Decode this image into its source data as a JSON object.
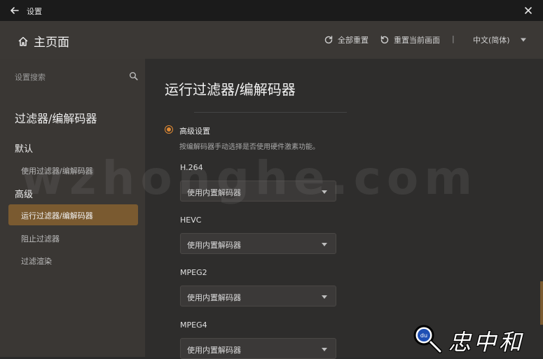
{
  "window": {
    "title": "设置"
  },
  "header": {
    "home_label": "主页面",
    "reset_all": "全部重置",
    "reset_page": "重置当前画面",
    "separator": "|",
    "language": "中文(简体)"
  },
  "sidebar": {
    "search_placeholder": "设置搜索",
    "section_title": "过滤器/编解码器",
    "groups": [
      {
        "label": "默认",
        "items": [
          "使用过滤器/编解码器"
        ]
      },
      {
        "label": "高级",
        "items": [
          "运行过滤器/编解码器",
          "阻止过滤器",
          "过滤渲染"
        ]
      }
    ]
  },
  "main": {
    "title": "运行过滤器/编解码器",
    "advanced": {
      "label": "高级设置",
      "description": "按编解码器手动选择是否使用硬件激素功能。",
      "selected": true
    },
    "codecs": [
      {
        "label": "H.264",
        "value": "使用内置解码器"
      },
      {
        "label": "HEVC",
        "value": "使用内置解码器"
      },
      {
        "label": "MPEG2",
        "value": "使用内置解码器"
      },
      {
        "label": "MPEG4",
        "value": "使用内置解码器"
      }
    ]
  },
  "overlay": {
    "watermark": "wzhonghe.com",
    "logo_text": "忠中和",
    "logo_badge": "du"
  },
  "colors": {
    "accent": "#e08a34",
    "active_item": "#7a5a30"
  }
}
